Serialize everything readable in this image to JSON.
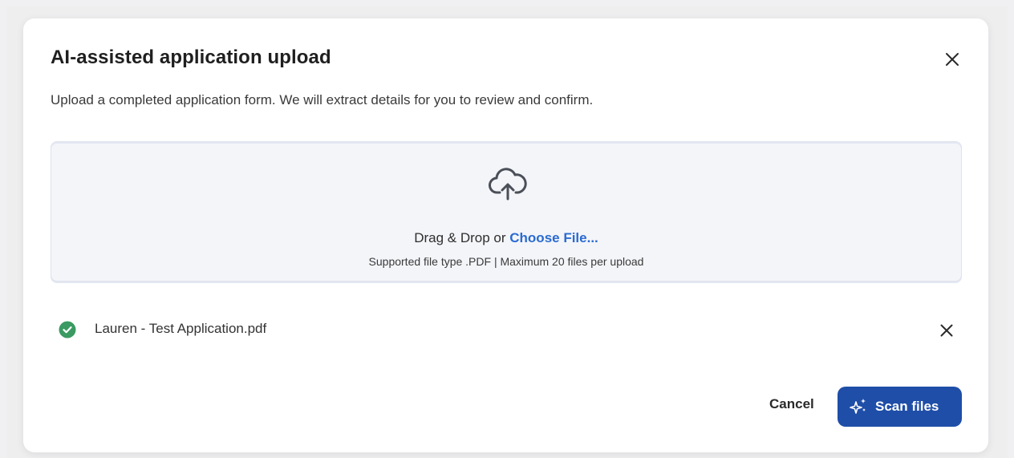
{
  "dialog": {
    "title": "AI-assisted application upload",
    "subtitle": "Upload a completed application form. We will extract details for you to review and confirm.",
    "close_icon": "close-icon"
  },
  "dropzone": {
    "icon": "cloud-upload-icon",
    "drag_text": "Drag & Drop or",
    "choose_link": "Choose File...",
    "support_text": "Supported file type .PDF | Maximum 20 files per upload"
  },
  "files": [
    {
      "name": "Lauren - Test Application.pdf",
      "status_icon": "check-circle-icon",
      "status_color": "#3a9a62",
      "remove_icon": "close-icon"
    }
  ],
  "actions": {
    "cancel_label": "Cancel",
    "scan_label": "Scan files",
    "scan_icon": "sparkle-icon",
    "primary_color": "#1f4ea8"
  }
}
